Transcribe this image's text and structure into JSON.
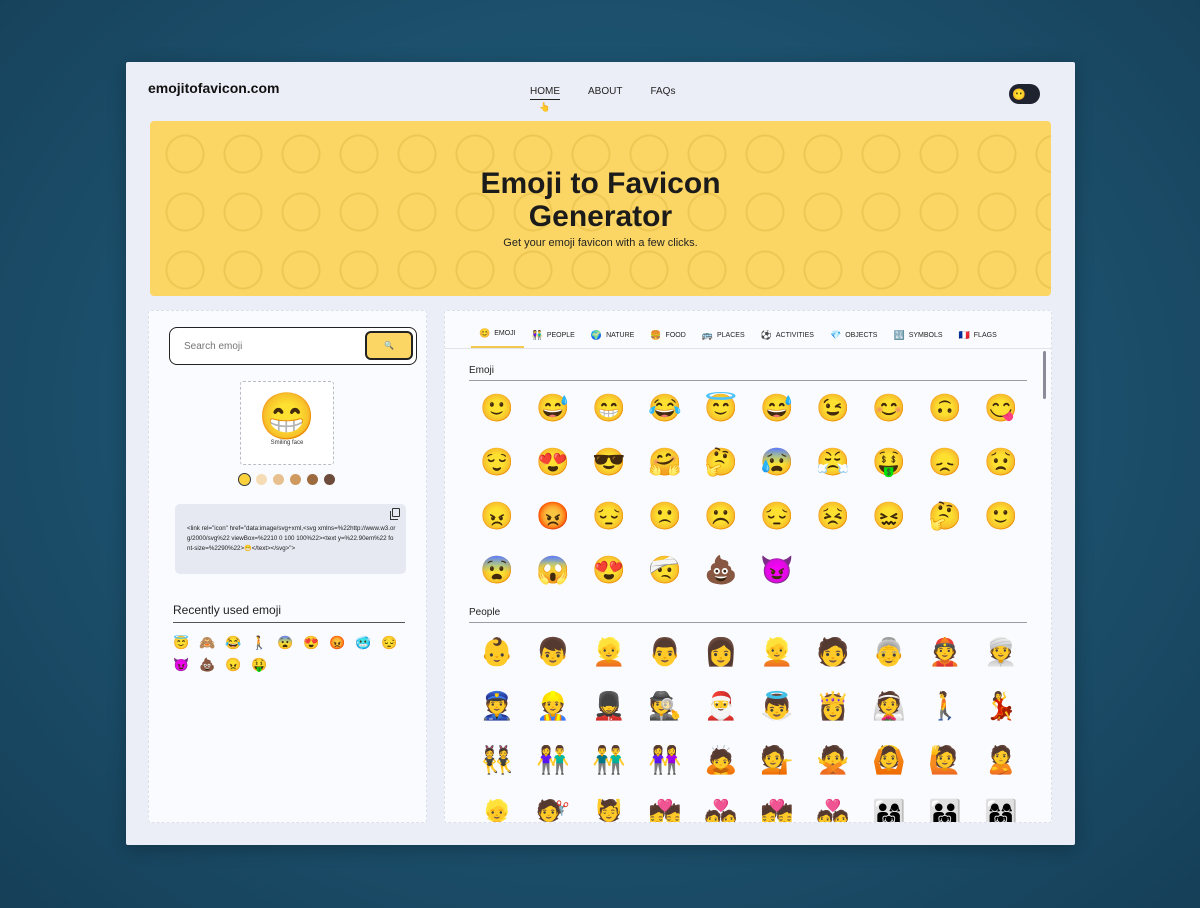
{
  "header": {
    "logo": "emojitofavicon.com",
    "nav": [
      {
        "label": "HOME",
        "active": true
      },
      {
        "label": "ABOUT",
        "active": false
      },
      {
        "label": "FAQs",
        "active": false
      }
    ],
    "nav_pointer": "👆",
    "theme_toggle_icon": "😶"
  },
  "hero": {
    "title_line1": "Emoji to Favicon",
    "title_line2": "Generator",
    "subtitle": "Get your emoji favicon with a few clicks.",
    "color": "#fcd664"
  },
  "search": {
    "placeholder": "Search emoji",
    "button_icon": "🔍"
  },
  "preview": {
    "emoji": "😁",
    "caption": "Smiling face"
  },
  "skin_tones": [
    "#fcd23c",
    "#f6dcb6",
    "#e8c08f",
    "#cf9a60",
    "#9c6a3f",
    "#6d4c3b"
  ],
  "code_snippet": "<link rel=\"icon\" href=\"data:image/svg+xml,<svg xmlns=%22http://www.w3.org/2000/svg%22 viewBox=%2210 0 100 100%22><text y=%22.90em%22 font-size=%2290%22>😁</text></svg>\">",
  "recent": {
    "title": "Recently used emoji",
    "items": [
      "😇",
      "🙈",
      "😂",
      "🚶",
      "😨",
      "😍",
      "😡",
      "🥶",
      "😔",
      "😈",
      "💩",
      "😠",
      "🤑"
    ]
  },
  "tabs": [
    {
      "icon": "😊",
      "label": "EMOJI",
      "active": true
    },
    {
      "icon": "👫",
      "label": "PEOPLE",
      "active": false
    },
    {
      "icon": "🌍",
      "label": "NATURE",
      "active": false
    },
    {
      "icon": "🍔",
      "label": "FOOD",
      "active": false
    },
    {
      "icon": "🚌",
      "label": "PLACES",
      "active": false
    },
    {
      "icon": "⚽",
      "label": "ACTIVITIES",
      "active": false
    },
    {
      "icon": "💎",
      "label": "OBJECTS",
      "active": false
    },
    {
      "icon": "🔣",
      "label": "SYMBOLS",
      "active": false
    },
    {
      "icon": "🇫🇷",
      "label": "FLAGS",
      "active": false
    }
  ],
  "sections": [
    {
      "label": "Emoji",
      "emojis": [
        "🙂",
        "😅",
        "😁",
        "😂",
        "😇",
        "😅",
        "😉",
        "😊",
        "🙃",
        "😋",
        "😌",
        "😍",
        "😎",
        "🤗",
        "🤔",
        "😰",
        "😤",
        "🤑",
        "😞",
        "😟",
        "😠",
        "😡",
        "😔",
        "🙁",
        "☹️",
        "😔",
        "😣",
        "😖",
        "🤔",
        "🙂",
        "😨",
        "😱",
        "😍",
        "🤕",
        "💩",
        "😈"
      ]
    },
    {
      "label": "People",
      "emojis": [
        "👶",
        "👦",
        "👱",
        "👨",
        "👩",
        "👱",
        "🧑",
        "👵",
        "👲",
        "👳",
        "👮",
        "👷",
        "💂",
        "🕵️",
        "🎅",
        "👼",
        "👸",
        "👰",
        "🚶",
        "💃",
        "👯",
        "👫",
        "👬",
        "👭",
        "🙇",
        "💁",
        "🙅",
        "🙆",
        "🙋",
        "🙎",
        "👱",
        "💇",
        "💆",
        "💏",
        "💑",
        "💏",
        "💑",
        "👨‍👩‍👧",
        "👨‍👨‍👧",
        "👩‍👩‍👧"
      ]
    }
  ]
}
